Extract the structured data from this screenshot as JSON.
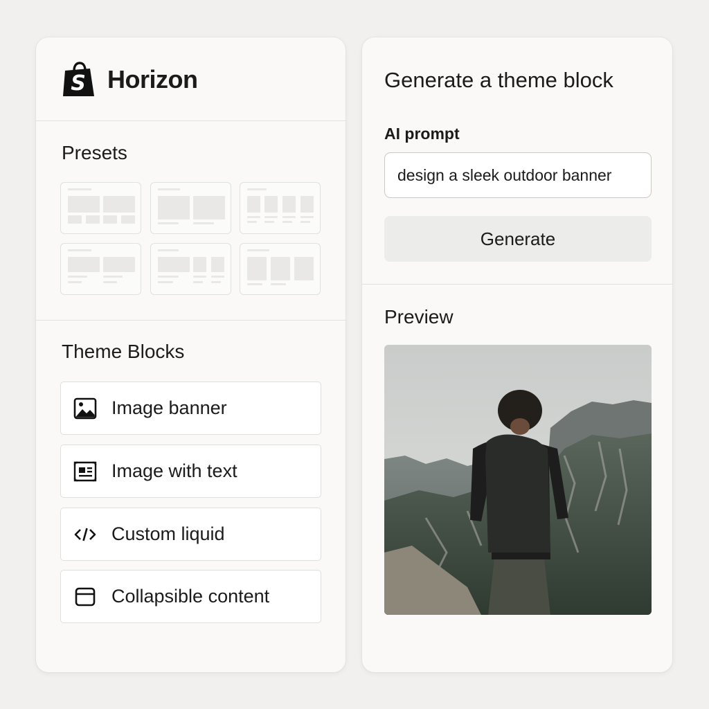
{
  "app": {
    "brand_name": "Horizon"
  },
  "presets": {
    "title": "Presets",
    "count": 6
  },
  "theme_blocks": {
    "title": "Theme Blocks",
    "items": [
      {
        "label": "Image banner",
        "icon": "image-icon"
      },
      {
        "label": "Image with text",
        "icon": "image-with-text-icon"
      },
      {
        "label": "Custom liquid",
        "icon": "code-icon"
      },
      {
        "label": "Collapsible content",
        "icon": "collapsible-icon"
      }
    ]
  },
  "generator": {
    "heading": "Generate a theme block",
    "prompt_label": "AI prompt",
    "prompt_value": "design a sleek outdoor banner",
    "generate_label": "Generate"
  },
  "preview": {
    "title": "Preview"
  },
  "colors": {
    "background": "#f1f0ee",
    "panel": "#faf9f7",
    "brand": "#111111",
    "button": "#ececea"
  }
}
